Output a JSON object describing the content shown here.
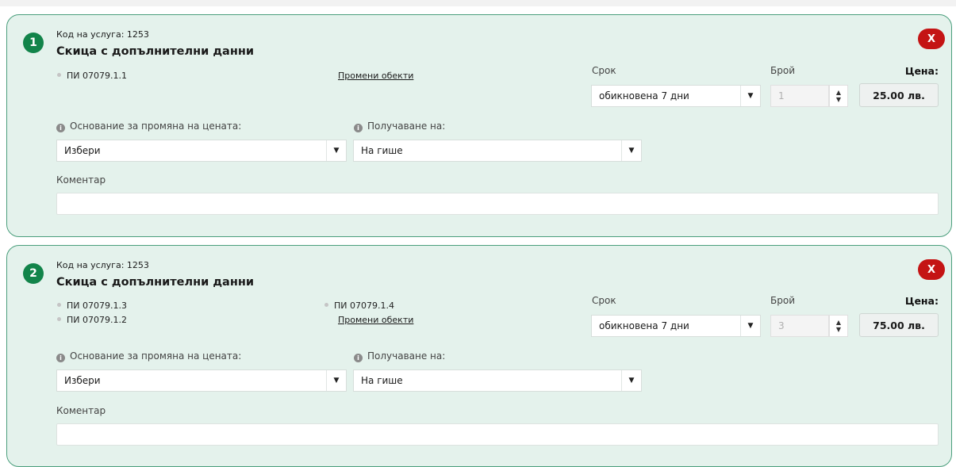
{
  "services": [
    {
      "number": "1",
      "code_label": "Код на услуга: 1253",
      "title": "Скица с допълнителни данни",
      "close_label": "X",
      "objects": [
        "ПИ 07079.1.1"
      ],
      "change_objects_label": "Промени обекти",
      "term_label": "Срок",
      "term_value": "обикновена 7 дни",
      "count_label": "Брой",
      "count_value": "1",
      "price_label": "Цена:",
      "price_value": "25.00 лв.",
      "basis_label": "Основание за промяна на цената:",
      "basis_value": "Избери",
      "receive_label": "Получаване на:",
      "receive_value": "На гише",
      "comment_label": "Коментар",
      "comment_value": ""
    },
    {
      "number": "2",
      "code_label": "Код на услуга: 1253",
      "title": "Скица с допълнителни данни",
      "close_label": "X",
      "objects": [
        "ПИ 07079.1.3",
        "ПИ 07079.1.2",
        "ПИ 07079.1.4"
      ],
      "change_objects_label": "Промени обекти",
      "term_label": "Срок",
      "term_value": "обикновена 7 дни",
      "count_label": "Брой",
      "count_value": "3",
      "price_label": "Цена:",
      "price_value": "75.00 лв.",
      "basis_label": "Основание за промяна на цената:",
      "basis_value": "Избери",
      "receive_label": "Получаване на:",
      "receive_value": "На гише",
      "comment_label": "Коментар",
      "comment_value": ""
    }
  ],
  "icons": {
    "info": "i",
    "select_caret": "▼",
    "spin_up": "▲",
    "spin_down": "▼"
  },
  "colors": {
    "card_bg": "#e4f2ec",
    "card_border": "#4a9e7c",
    "badge_green": "#12844a",
    "close_red": "#c41414"
  }
}
